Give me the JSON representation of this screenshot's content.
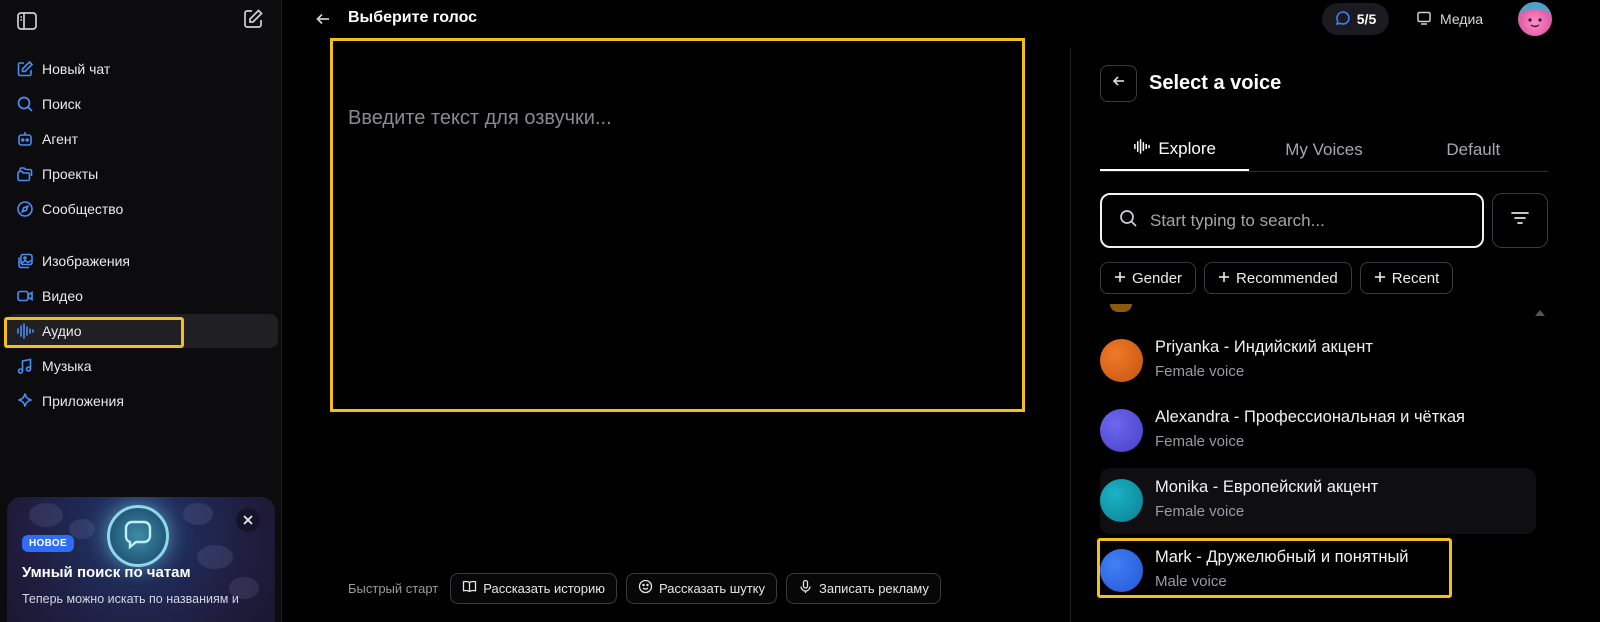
{
  "sidebar": {
    "nav": [
      {
        "label": "Новый чат",
        "icon": "pencil-square-icon"
      },
      {
        "label": "Поиск",
        "icon": "search-icon"
      },
      {
        "label": "Агент",
        "icon": "robot-icon"
      },
      {
        "label": "Проекты",
        "icon": "folders-icon"
      },
      {
        "label": "Сообщество",
        "icon": "compass-icon"
      },
      {
        "label": "Изображения",
        "icon": "images-icon"
      },
      {
        "label": "Видео",
        "icon": "video-icon"
      },
      {
        "label": "Аудио",
        "icon": "audio-wave-icon",
        "active": true
      },
      {
        "label": "Музыка",
        "icon": "music-note-icon"
      },
      {
        "label": "Приложения",
        "icon": "sparkle-icon"
      }
    ],
    "promo": {
      "badge": "НОВОЕ",
      "title": "Умный поиск по чатам",
      "description": "Теперь можно искать по названиям и"
    }
  },
  "header": {
    "title": "Выберите голос",
    "credits": "5/5",
    "media_label": "Медиа"
  },
  "editor": {
    "placeholder": "Введите текст для озвучки..."
  },
  "quick_start": {
    "label": "Быстрый старт",
    "buttons": [
      "Рассказать историю",
      "Рассказать шутку",
      "Записать рекламу"
    ]
  },
  "voice_panel": {
    "title": "Select a voice",
    "tabs": [
      "Explore",
      "My Voices",
      "Default"
    ],
    "search_placeholder": "Start typing to search...",
    "chips": [
      "Gender",
      "Recommended",
      "Recent"
    ],
    "voices": [
      {
        "name": "Priyanka - Индийский акцент",
        "type": "Female voice",
        "color": "#e2651a"
      },
      {
        "name": "Alexandra - Профессиональная и чёткая",
        "type": "Female voice",
        "color": "#5a55e0"
      },
      {
        "name": "Monika - Европейский акцент",
        "type": "Female voice",
        "color": "#0f9bb0"
      },
      {
        "name": "Mark - Дружелюбный и понятный",
        "type": "Male voice",
        "color": "#2f6cf0"
      }
    ]
  },
  "colors": {
    "accent_blue": "#3b82f6",
    "highlight": "#f5be1a"
  }
}
